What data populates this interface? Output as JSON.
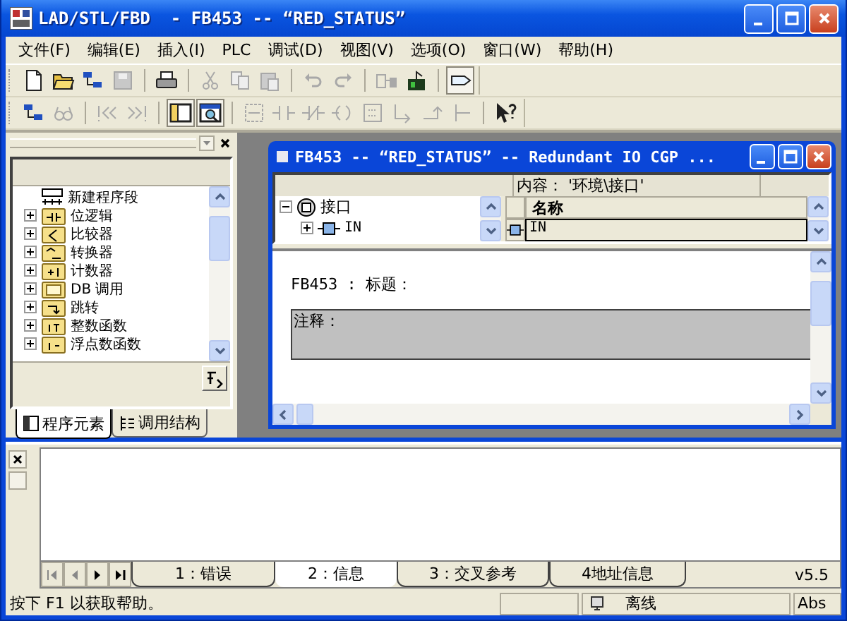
{
  "window": {
    "title": "LAD/STL/FBD  - FB453 -- “RED_STATUS”"
  },
  "menu": [
    "文件(F)",
    "编辑(E)",
    "插入(I)",
    "PLC",
    "调试(D)",
    "视图(V)",
    "选项(O)",
    "窗口(W)",
    "帮助(H)"
  ],
  "toolbars": [
    [
      [
        {
          "kind": "new",
          "disabled": false,
          "pressed": false
        },
        {
          "kind": "open",
          "disabled": false,
          "pressed": false
        },
        {
          "kind": "nodes",
          "disabled": false,
          "pressed": false
        },
        {
          "kind": "save",
          "disabled": true,
          "pressed": false
        }
      ],
      [
        {
          "kind": "print",
          "disabled": false,
          "pressed": false
        }
      ],
      [
        {
          "kind": "cut",
          "disabled": true,
          "pressed": false
        },
        {
          "kind": "copy",
          "disabled": true,
          "pressed": false
        },
        {
          "kind": "paste",
          "disabled": true,
          "pressed": false
        }
      ],
      [
        {
          "kind": "undo",
          "disabled": true,
          "pressed": false
        },
        {
          "kind": "redo",
          "disabled": true,
          "pressed": false
        }
      ],
      [
        {
          "kind": "download",
          "disabled": true,
          "pressed": false
        },
        {
          "kind": "module",
          "disabled": false,
          "pressed": false
        }
      ],
      [
        {
          "kind": "tag",
          "disabled": false,
          "pressed": true
        }
      ]
    ],
    [
      [
        {
          "kind": "nodes",
          "disabled": false,
          "pressed": false
        },
        {
          "kind": "glasses",
          "disabled": true,
          "pressed": false
        }
      ],
      [
        {
          "kind": "first",
          "disabled": true,
          "pressed": false
        },
        {
          "kind": "last",
          "disabled": true,
          "pressed": false
        }
      ],
      [
        {
          "kind": "overview",
          "disabled": false,
          "pressed": true
        },
        {
          "kind": "catalog",
          "disabled": false,
          "pressed": true
        }
      ],
      [
        {
          "kind": "network",
          "disabled": true,
          "pressed": false
        },
        {
          "kind": "contact",
          "disabled": true,
          "pressed": false
        },
        {
          "kind": "ncontact",
          "disabled": true,
          "pressed": false
        },
        {
          "kind": "coil",
          "disabled": true,
          "pressed": false
        },
        {
          "kind": "box",
          "disabled": true,
          "pressed": false
        },
        {
          "kind": "branch",
          "disabled": true,
          "pressed": false
        },
        {
          "kind": "branchclose",
          "disabled": true,
          "pressed": false
        },
        {
          "kind": "rail",
          "disabled": true,
          "pressed": false
        }
      ],
      [
        {
          "kind": "whatsthis",
          "disabled": false,
          "pressed": false
        }
      ]
    ]
  ],
  "elements_panel": {
    "items": [
      {
        "label": "新建程序段",
        "kind": "leaf"
      },
      {
        "label": "位逻辑",
        "kind": "group",
        "expanded": false
      },
      {
        "label": "比较器",
        "kind": "group",
        "expanded": false
      },
      {
        "label": "转换器",
        "kind": "group",
        "expanded": false
      },
      {
        "label": "计数器",
        "kind": "group",
        "expanded": false
      },
      {
        "label": "DB 调用",
        "kind": "group",
        "expanded": false
      },
      {
        "label": "跳转",
        "kind": "group",
        "expanded": false
      },
      {
        "label": "整数函数",
        "kind": "group",
        "expanded": false
      },
      {
        "label": "浮点数函数",
        "kind": "group",
        "expanded": false
      }
    ],
    "tabs": [
      {
        "label": "程序元素",
        "selected": true
      },
      {
        "label": "调用结构",
        "selected": false
      }
    ]
  },
  "editor_window": {
    "title": "FB453 -- “RED_STATUS” -- Redundant IO CGP ...",
    "content_path": "内容： '环境\\接口'",
    "tree": [
      {
        "label": "接口",
        "expanded": true,
        "children": [
          {
            "label": "IN",
            "expanded": false
          }
        ]
      }
    ],
    "table": {
      "columns": [
        "名称"
      ],
      "rows": [
        {
          "name": "IN"
        }
      ]
    },
    "block_title": "FB453 : 标题：",
    "comment": "注释："
  },
  "output": {
    "tabs": [
      {
        "label": "1：错误",
        "selected": false
      },
      {
        "label": "2：信息",
        "selected": true
      },
      {
        "label": "3：交叉参考",
        "selected": false
      },
      {
        "label": "4地址信息",
        "selected": false
      }
    ],
    "version": "v5.5"
  },
  "status_bar": {
    "help": "按下 F1 以获取帮助。",
    "mode": "离线",
    "address_mode": "Abs"
  }
}
